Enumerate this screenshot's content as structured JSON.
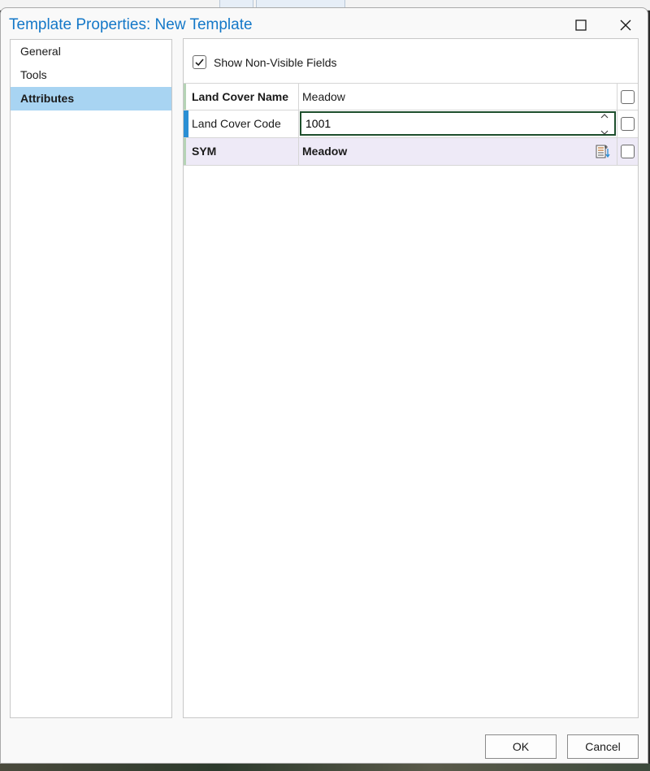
{
  "dialog": {
    "title": "Template Properties: New Template"
  },
  "nav": {
    "items": [
      {
        "label": "General"
      },
      {
        "label": "Tools"
      },
      {
        "label": "Attributes"
      }
    ],
    "selected": "Attributes"
  },
  "attributes": {
    "show_non_visible_label": "Show Non-Visible Fields",
    "show_non_visible_checked": true,
    "rows": [
      {
        "field": "Land Cover Name",
        "value": "Meadow",
        "visible": false
      },
      {
        "field": "Land Cover Code",
        "value": "1001",
        "visible": false,
        "editing": true
      },
      {
        "field": "SYM",
        "value": "Meadow",
        "visible": false
      }
    ]
  },
  "buttons": {
    "ok": "OK",
    "cancel": "Cancel"
  },
  "colors": {
    "title": "#1478c8",
    "selected_nav": "#a8d4f2",
    "active_marker": "#2a8fd4",
    "edit_border": "#1e4f2d",
    "sym_row": "#eeeaf7"
  },
  "icons": {
    "maximize": "maximize-icon",
    "close": "close-icon",
    "check": "checkmark-icon",
    "spin_up": "chevron-up-icon",
    "spin_down": "chevron-down-icon",
    "symbol_picker": "symbol-list-icon"
  }
}
